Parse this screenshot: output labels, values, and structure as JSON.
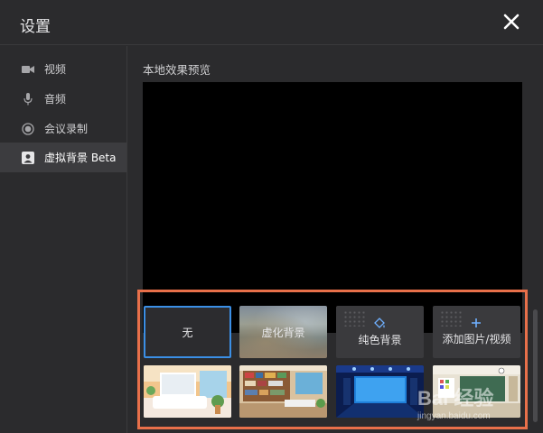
{
  "dialog": {
    "title": "设置"
  },
  "sidebar": {
    "items": [
      {
        "label": "视频",
        "icon": "video-camera-icon"
      },
      {
        "label": "音频",
        "icon": "microphone-icon"
      },
      {
        "label": "会议录制",
        "icon": "record-icon"
      },
      {
        "label": "虚拟背景 Beta",
        "icon": "portrait-icon",
        "active": true
      }
    ]
  },
  "main": {
    "preview_title": "本地效果预览",
    "backgrounds": [
      {
        "label": "无",
        "selected": true
      },
      {
        "label": "虚化背景"
      },
      {
        "label": "纯色背景",
        "icon": "paint-bucket-icon"
      },
      {
        "label": "添加图片/视频",
        "icon": "plus-icon"
      }
    ],
    "scenes": [
      "bedroom-scene",
      "library-scene",
      "stage-scene",
      "classroom-scene"
    ]
  },
  "watermark": {
    "text": "Bai 经验",
    "sub": "jingyan.baidu.com"
  },
  "colors": {
    "accent": "#3b8fe6",
    "highlight": "#e8704a",
    "panel": "#2b2b2d",
    "active": "#3c3c3f"
  }
}
